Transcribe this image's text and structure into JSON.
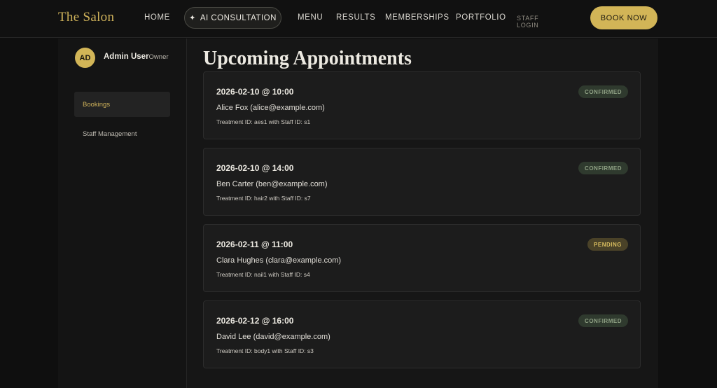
{
  "header": {
    "brand": "The Salon",
    "nav": {
      "home": "HOME",
      "ai": "AI CONSULTATION",
      "menu": "MENU",
      "results": "RESULTS",
      "memberships": "MEMBERSHIPS",
      "portfolio": "PORTFOLIO",
      "staff_login": "STAFF LOGIN"
    },
    "book_now": "BOOK NOW"
  },
  "sidebar": {
    "avatar_initials": "AD",
    "user_name": "Admin User",
    "user_role": "Owner",
    "items": [
      {
        "label": "Bookings",
        "active": true
      },
      {
        "label": "Staff Management",
        "active": false
      }
    ]
  },
  "main": {
    "title": "Upcoming Appointments",
    "appointments": [
      {
        "datetime": "2026-02-10 @ 10:00",
        "client": "Alice Fox (alice@example.com)",
        "meta": "Treatment ID: aes1 with Staff ID: s1",
        "status": "CONFIRMED"
      },
      {
        "datetime": "2026-02-10 @ 14:00",
        "client": "Ben Carter (ben@example.com)",
        "meta": "Treatment ID: hair2 with Staff ID: s7",
        "status": "CONFIRMED"
      },
      {
        "datetime": "2026-02-11 @ 11:00",
        "client": "Clara Hughes (clara@example.com)",
        "meta": "Treatment ID: nail1 with Staff ID: s4",
        "status": "PENDING"
      },
      {
        "datetime": "2026-02-12 @ 16:00",
        "client": "David Lee (david@example.com)",
        "meta": "Treatment ID: body1 with Staff ID: s3",
        "status": "CONFIRMED"
      }
    ]
  },
  "colors": {
    "accent": "#d2b557",
    "confirmed_bg": "#2f3a2e",
    "confirmed_text": "#8fa184",
    "pending_bg": "#4a4228",
    "pending_text": "#d9bd5f"
  },
  "icons": {
    "ai_consultation": "sparkle-icon"
  }
}
